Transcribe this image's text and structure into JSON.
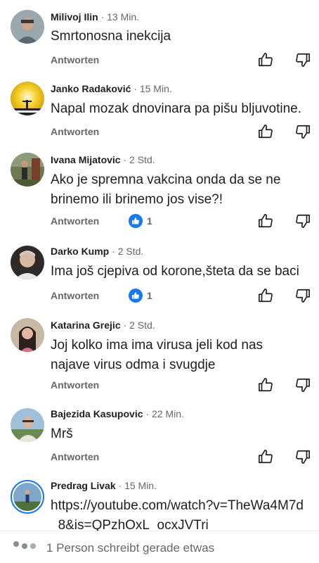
{
  "comments": [
    {
      "name": "Milivoj Ilin",
      "time": "13 Min.",
      "text": "Smrtonosna inekcija",
      "reply": "Antworten",
      "likes": ""
    },
    {
      "name": "Janko Radaković",
      "time": "15 Min.",
      "text": "Napal mozak dnovinara pa pišu bljuvotine.",
      "reply": "Antworten",
      "likes": ""
    },
    {
      "name": "Ivana Mijatovic",
      "time": "2 Std.",
      "text": "Ako je spremna vakcina onda da se ne brinemo ili brinemo jos vise?!",
      "reply": "Antworten",
      "likes": "1"
    },
    {
      "name": "Darko Kump",
      "time": "2 Std.",
      "text": "Ima još cjepiva od korone,šteta da se baci",
      "reply": "Antworten",
      "likes": "1"
    },
    {
      "name": "Katarina Grejic",
      "time": "2 Std.",
      "text": "Joj kolko ima ima virusa jeli kod nas najave virus odma i svugdje",
      "reply": "Antworten",
      "likes": ""
    },
    {
      "name": "Bajezida Kasupovic",
      "time": "22 Min.",
      "text": "Mrš",
      "reply": "Antworten",
      "likes": ""
    },
    {
      "name": "Predrag Livak",
      "time": "15 Min.",
      "text": "https://youtube.com/watch?v=TheWa4M7d_8&is=QPzhOxL_ocxJVTri",
      "reply": "",
      "likes": ""
    }
  ],
  "separator": "·",
  "typing": {
    "text": "1 Person schreibt gerade etwas"
  },
  "colors": {
    "accent": "#1877f2",
    "muted": "#65676b"
  }
}
